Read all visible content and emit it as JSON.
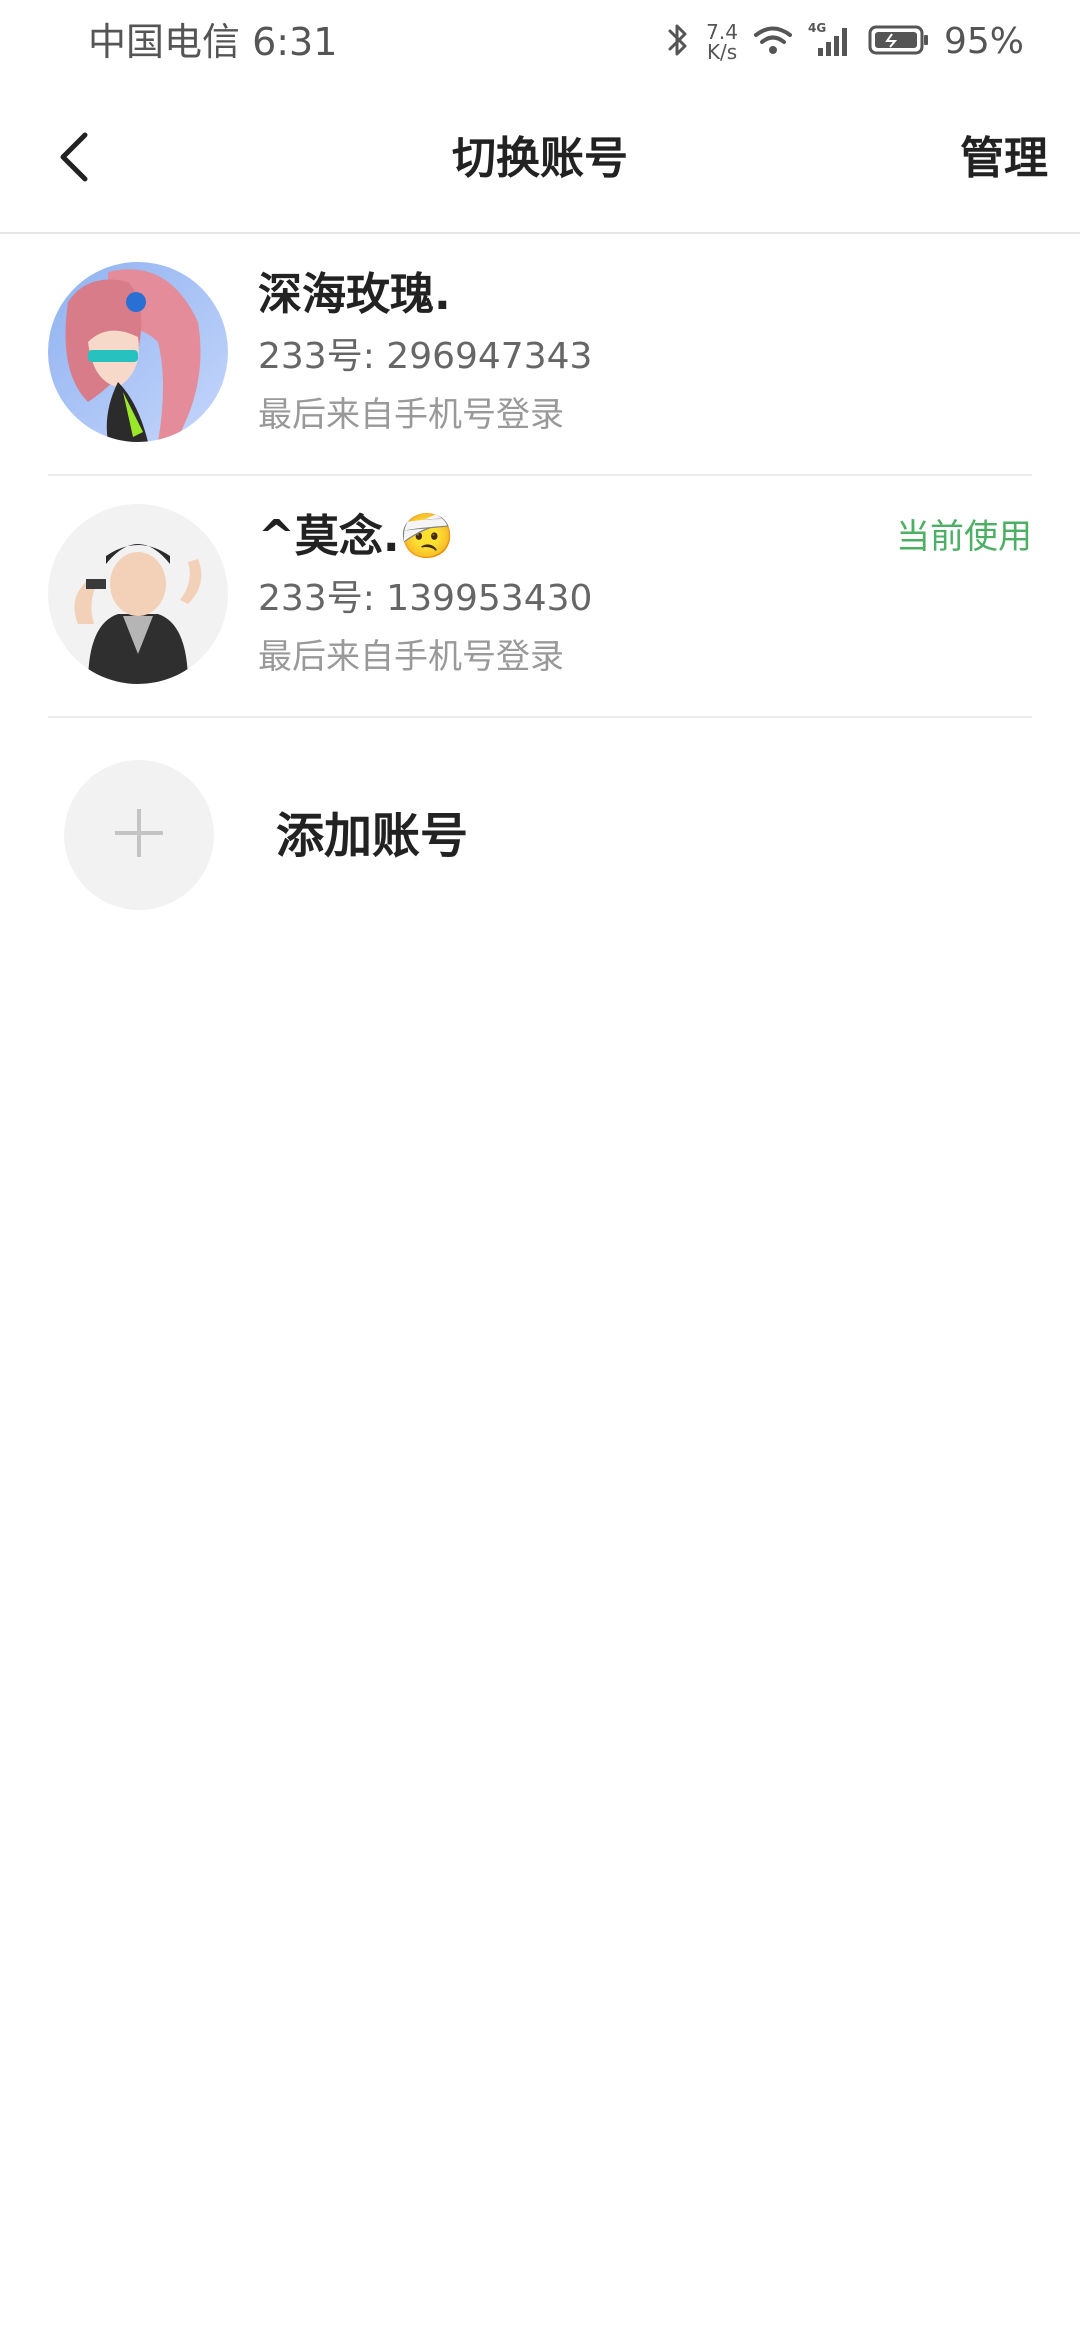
{
  "status_bar": {
    "carrier_time": "中国电信 6:31",
    "net_speed_value": "7.4",
    "net_speed_unit": "K/s",
    "network_type": "4G",
    "battery_percent": "95%"
  },
  "header": {
    "title": "切换账号",
    "manage_label": "管理"
  },
  "accounts": [
    {
      "name": "深海玫瑰.",
      "id_text": "233号: 296947343",
      "login_text": "最后来自手机号登录",
      "current": false
    },
    {
      "name": "^莫念.🤕",
      "id_text": "233号: 139953430",
      "login_text": "最后来自手机号登录",
      "current": true,
      "current_label": "当前使用"
    }
  ],
  "add_account": {
    "label": "添加账号"
  },
  "colors": {
    "accent_green": "#4caf63",
    "text_primary": "#222222",
    "text_secondary": "#666666",
    "text_tertiary": "#999999",
    "divider": "#ececec"
  }
}
